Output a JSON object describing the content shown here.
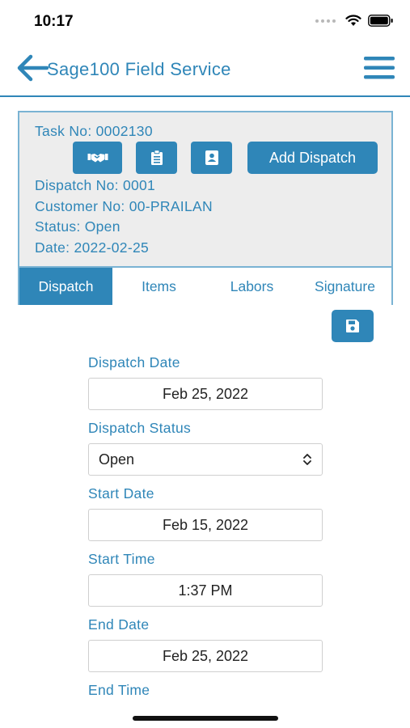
{
  "status_bar": {
    "time": "10:17"
  },
  "nav": {
    "title": "Sage100 Field Service"
  },
  "task": {
    "task_no": "Task No: 0002130",
    "add_dispatch_label": "Add Dispatch",
    "dispatch_no": "Dispatch No: 0001",
    "customer_no": "Customer No: 00-PRAILAN",
    "status": "Status: Open",
    "date": "Date: 2022-02-25"
  },
  "tabs": [
    {
      "label": "Dispatch",
      "active": true
    },
    {
      "label": "Items",
      "active": false
    },
    {
      "label": "Labors",
      "active": false
    },
    {
      "label": "Signature",
      "active": false
    }
  ],
  "form": {
    "dispatch_date_label": "Dispatch Date",
    "dispatch_date_value": "Feb 25, 2022",
    "dispatch_status_label": "Dispatch Status",
    "dispatch_status_value": "Open",
    "start_date_label": "Start Date",
    "start_date_value": "Feb 15, 2022",
    "start_time_label": "Start Time",
    "start_time_value": "1:37 PM",
    "end_date_label": "End Date",
    "end_date_value": "Feb 25, 2022",
    "end_time_label": "End Time"
  },
  "icons": {
    "back": "arrow-left-icon",
    "menu": "hamburger-menu-icon",
    "handshake": "handshake-icon",
    "clipboard": "clipboard-icon",
    "contact": "contact-card-icon",
    "save": "save-icon"
  },
  "colors": {
    "accent": "#2f86b8",
    "panel_bg": "#ededed",
    "panel_border": "#7ab3d3"
  }
}
